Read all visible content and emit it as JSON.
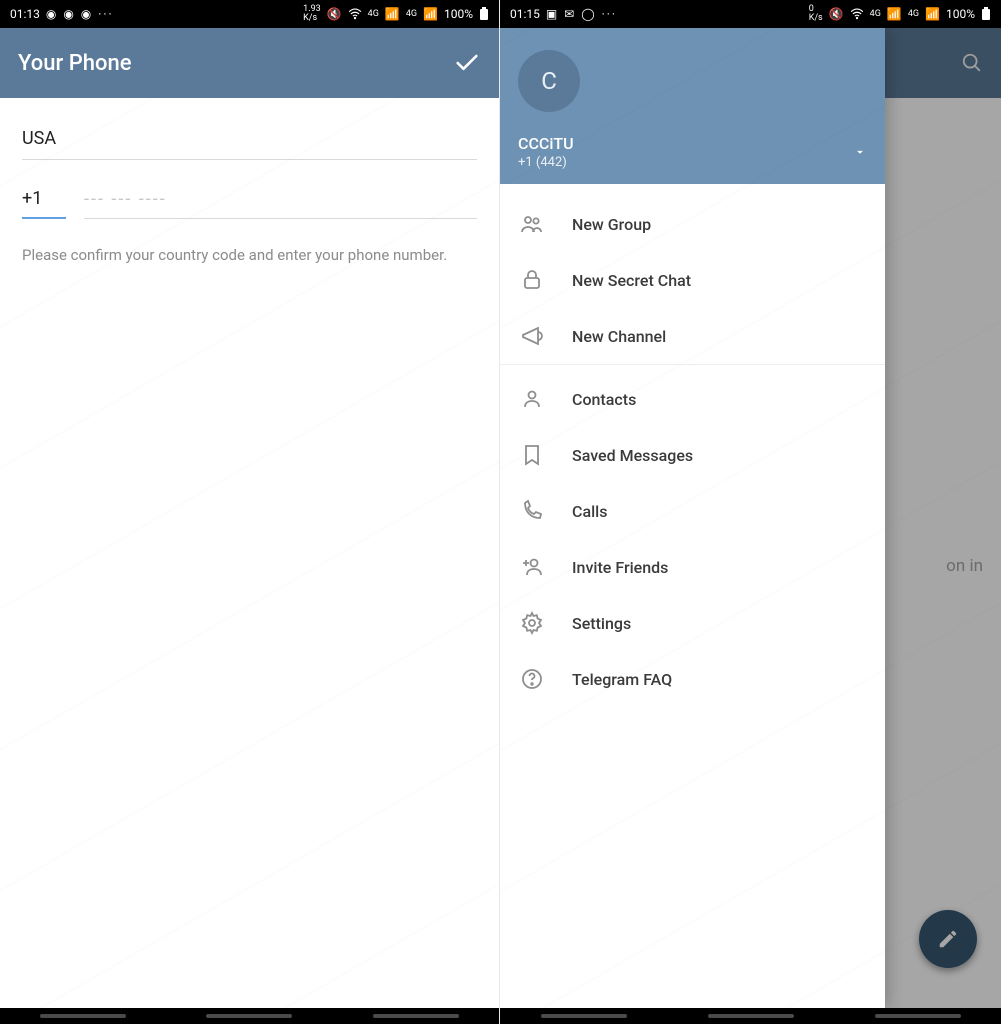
{
  "left": {
    "status": {
      "time": "01:13",
      "kbps": "1.93",
      "kbps_unit": "K/s",
      "net": "4G",
      "battery": "100%"
    },
    "appbar": {
      "title": "Your Phone"
    },
    "login": {
      "country": "USA",
      "dial_code": "+1",
      "digits_placeholder": "--- --- ----",
      "hint": "Please confirm your country code and enter your phone number."
    }
  },
  "right": {
    "status": {
      "time": "01:15",
      "kbps": "0",
      "kbps_unit": "K/s",
      "net": "4G",
      "battery": "100%"
    },
    "bg_fragment": "on in",
    "drawer": {
      "avatar_initial": "C",
      "name": "CCCiTU",
      "phone": "+1 (442)",
      "sections": [
        [
          {
            "key": "new-group",
            "label": "New Group"
          },
          {
            "key": "new-secret",
            "label": "New Secret Chat"
          },
          {
            "key": "new-channel",
            "label": "New Channel"
          }
        ],
        [
          {
            "key": "contacts",
            "label": "Contacts"
          },
          {
            "key": "saved",
            "label": "Saved Messages"
          },
          {
            "key": "calls",
            "label": "Calls"
          },
          {
            "key": "invite",
            "label": "Invite Friends"
          },
          {
            "key": "settings",
            "label": "Settings"
          },
          {
            "key": "faq",
            "label": "Telegram FAQ"
          }
        ]
      ]
    }
  }
}
